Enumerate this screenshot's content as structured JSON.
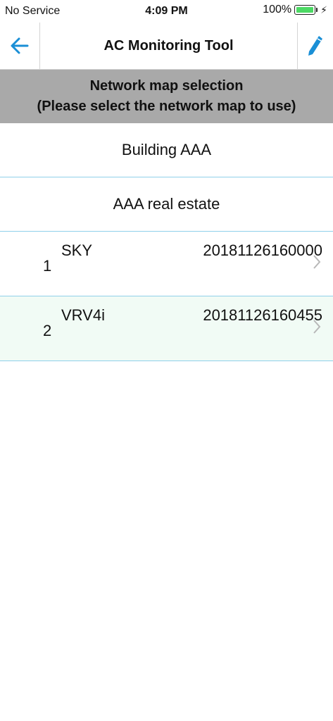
{
  "status_bar": {
    "carrier": "No Service",
    "time": "4:09 PM",
    "battery_percent": "100%",
    "battery_level": 1.0,
    "battery_color": "#4cd964"
  },
  "nav": {
    "title": "AC Monitoring Tool",
    "back_icon": "arrow-left-icon",
    "edit_icon": "pencil-icon",
    "accent_color": "#1a8fd6"
  },
  "section_header": {
    "line1": "Network map selection",
    "line2": "(Please select the network map to use)"
  },
  "levels": [
    {
      "label": "Building AAA"
    },
    {
      "label": "AAA real estate"
    }
  ],
  "maps": [
    {
      "index": "1",
      "name": "SKY",
      "date": "20181126160000"
    },
    {
      "index": "2",
      "name": "VRV4i",
      "date": "20181126160455"
    }
  ]
}
